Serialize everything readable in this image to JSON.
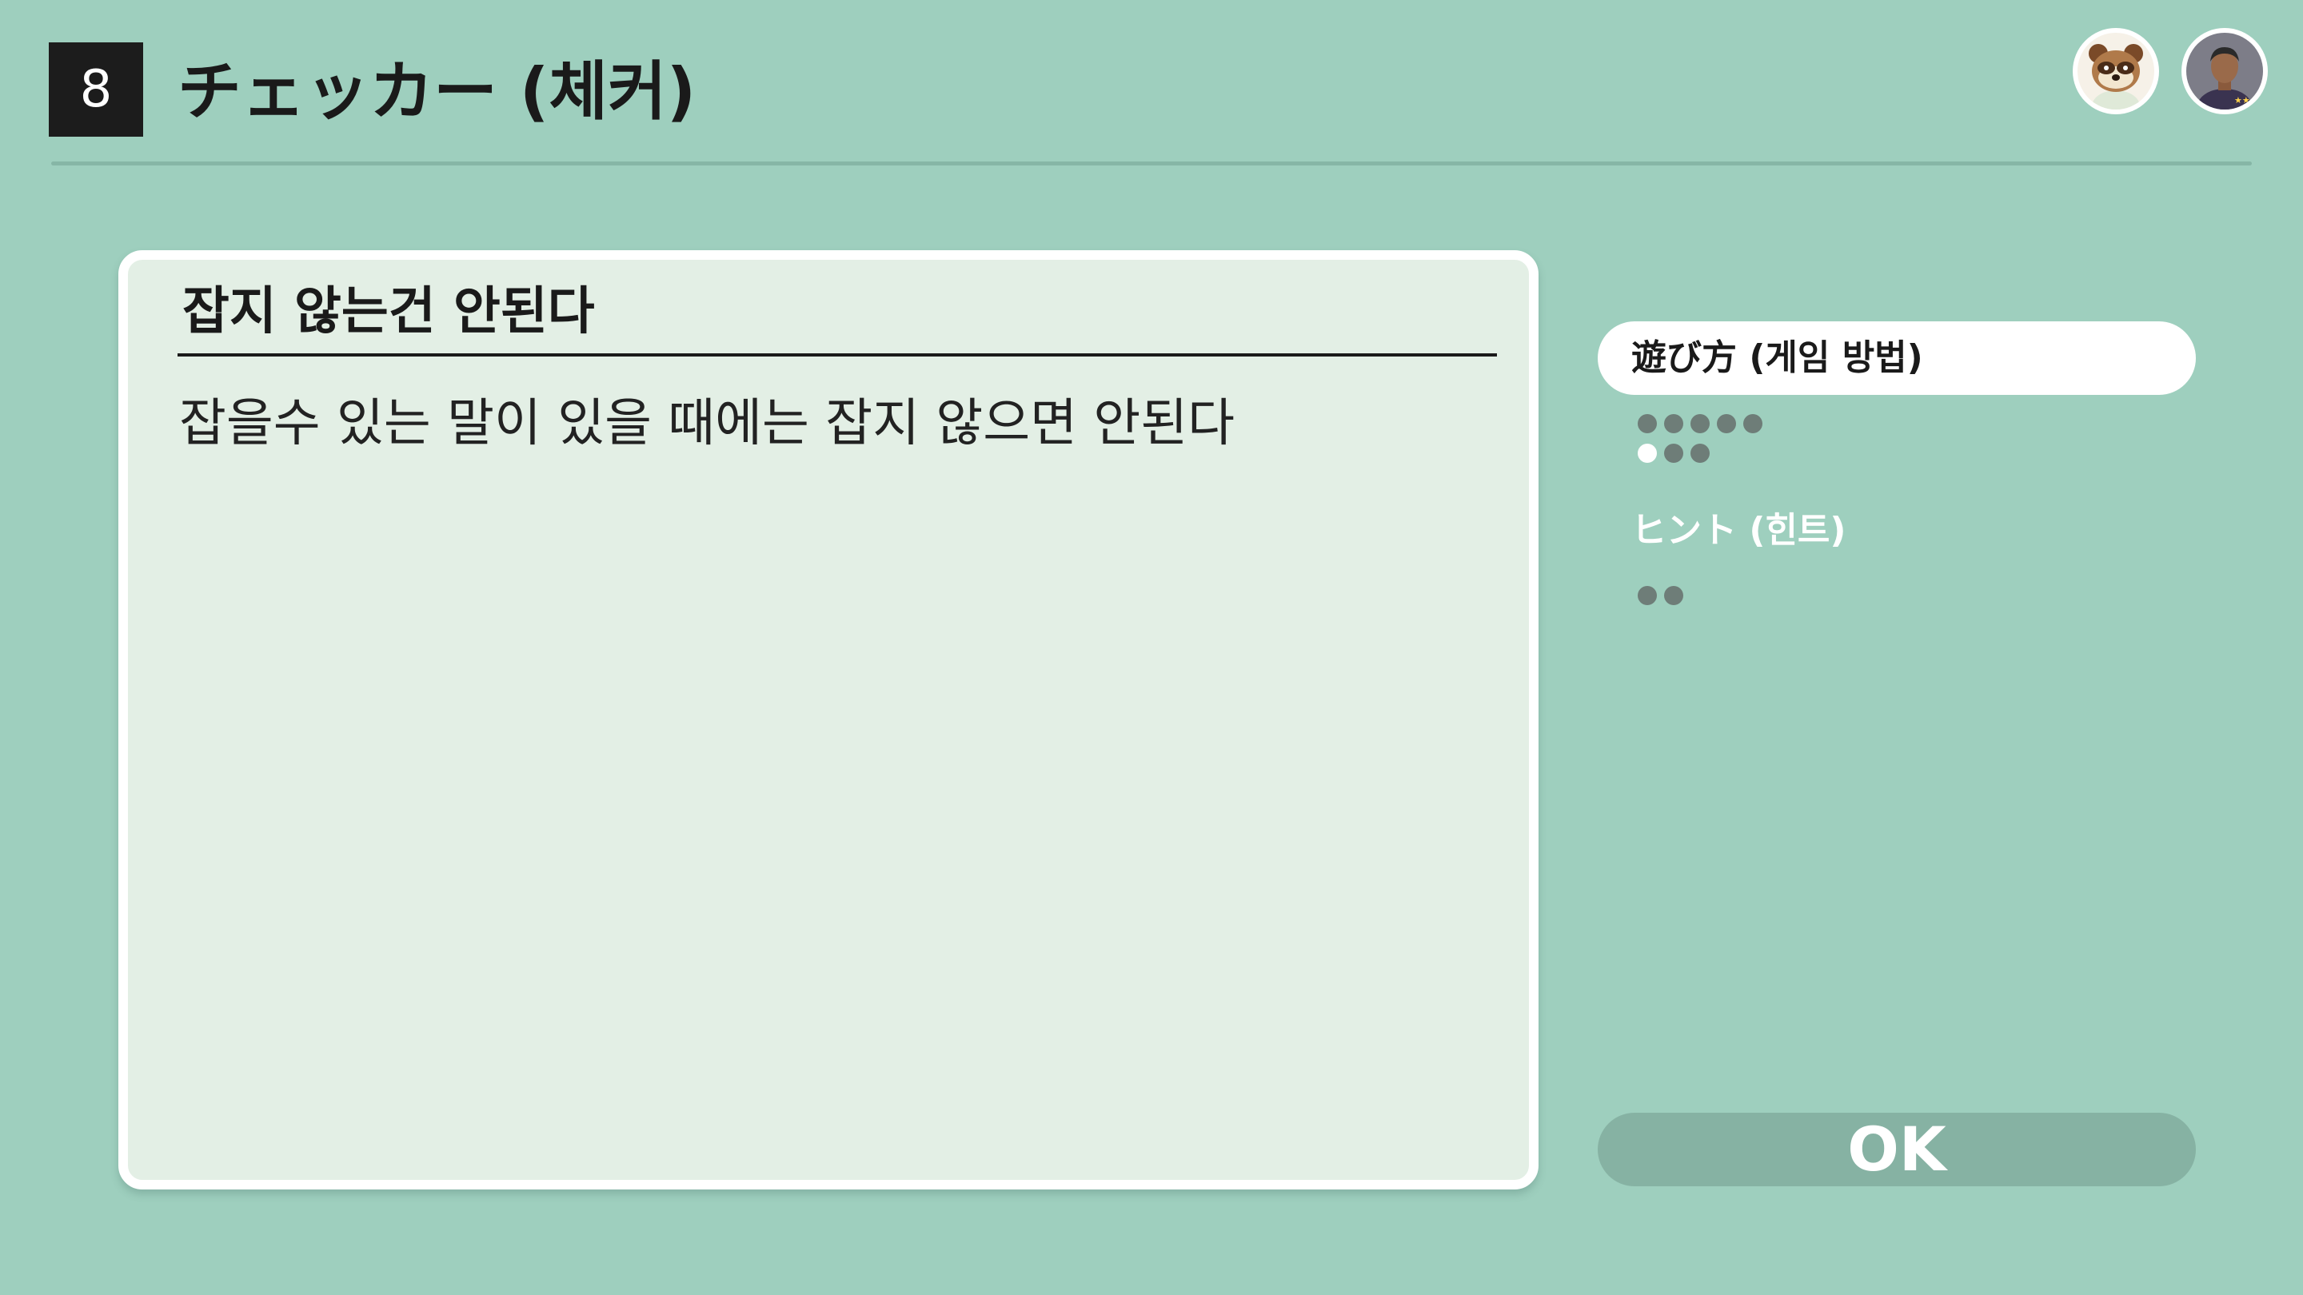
{
  "header": {
    "game_number": "8",
    "title": "チェッカー (체커)"
  },
  "players": [
    {
      "name": "tom-nook",
      "icon": "raccoon-avatar-icon"
    },
    {
      "name": "player",
      "icon": "person-avatar-icon"
    }
  ],
  "rule": {
    "heading": "잡지 않는건 안된다",
    "body": "잡을수 있는 말이 있을 때에는 잡지 않으면 안된다"
  },
  "menu": {
    "how_to_play_label": "遊び方 (게임 방법)",
    "how_to_play_pages_total": 8,
    "how_to_play_current_page": 6,
    "hint_label": "ヒント (힌트)",
    "hint_pages_total": 2,
    "hint_current_page": 0
  },
  "ok_button_label": "OK",
  "colors": {
    "background": "#9ecfbe",
    "panel": "#e3efe5",
    "ok_button": "#86b2a3",
    "dot_inactive": "#6e7d78",
    "dot_active": "#ffffff"
  }
}
